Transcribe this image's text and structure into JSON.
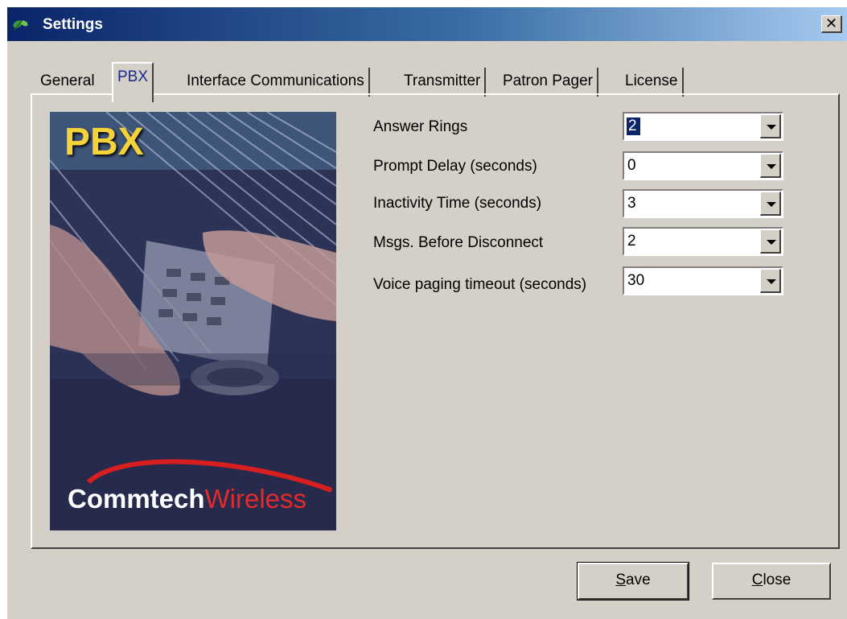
{
  "window": {
    "title": "Settings",
    "close_glyph": "✕"
  },
  "icons": {
    "app": "app-leaf-icon",
    "close": "close-icon",
    "dropdown": "chevron-down-icon"
  },
  "tabs": [
    {
      "label": "General",
      "active": false
    },
    {
      "label": "PBX",
      "active": true
    },
    {
      "label": "Interface Communications",
      "active": false
    },
    {
      "label": "Transmitter",
      "active": false
    },
    {
      "label": "Patron Pager",
      "active": false
    },
    {
      "label": "License",
      "active": false
    }
  ],
  "image": {
    "title": "PBX",
    "brand_part1": "Commtech",
    "brand_part2": "Wireless"
  },
  "fields": [
    {
      "label": "Answer Rings",
      "value": "2"
    },
    {
      "label": "Prompt Delay (seconds)",
      "value": "0"
    },
    {
      "label": "Inactivity Time (seconds)",
      "value": "3"
    },
    {
      "label": "Msgs. Before Disconnect",
      "value": "2"
    },
    {
      "label": "Voice paging timeout (seconds)",
      "value": "30"
    }
  ],
  "buttons": {
    "save_mnemonic": "S",
    "save_rest": "ave",
    "close_mnemonic": "C",
    "close_rest": "lose"
  },
  "colors": {
    "title_gradient_start": "#0a246a",
    "title_gradient_end": "#a6caf0",
    "dialog_face": "#d4d0c8",
    "pbx_title": "#f5d23a",
    "brand_red": "#e62a2a"
  }
}
